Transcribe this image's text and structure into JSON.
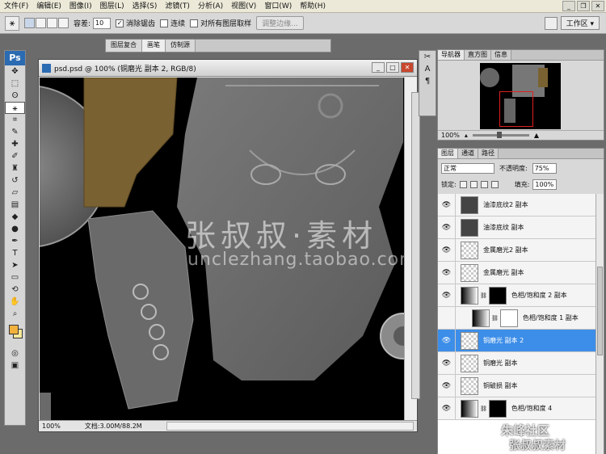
{
  "menu": [
    "文件(F)",
    "编辑(E)",
    "图像(I)",
    "图层(L)",
    "选择(S)",
    "滤镜(T)",
    "分析(A)",
    "视图(V)",
    "窗口(W)",
    "帮助(H)"
  ],
  "options": {
    "tolerance_label": "容差:",
    "tolerance_value": "10",
    "antialias_label": "消除锯齿",
    "contiguous_label": "连续",
    "sample_all_label": "对所有图层取样",
    "refine_edge_label": "调整边缘...",
    "workspace_label": "工作区"
  },
  "tabs": [
    "图层复合",
    "画笔",
    "仿制源"
  ],
  "document": {
    "title": "psd.psd @ 100% (铜磨光 副本 2, RGB/8)",
    "zoom": "100%",
    "doc_size": "文档:3.00M/88.2M"
  },
  "watermark": {
    "chinese": "张叔叔·素材",
    "url": "unclezhang.taobao.com"
  },
  "navigator": {
    "tabs": [
      "导航器",
      "直方图",
      "信息"
    ],
    "zoom": "100%"
  },
  "layers": {
    "tabs": [
      "图层",
      "通道",
      "路径"
    ],
    "blend_mode": "正常",
    "opacity_label": "不透明度:",
    "opacity_value": "75%",
    "lock_label": "锁定:",
    "fill_label": "填充:",
    "fill_value": "100%",
    "items": [
      {
        "name": "油漆底纹2 副本",
        "selected": false
      },
      {
        "name": "油漆底纹 副本",
        "selected": false
      },
      {
        "name": "金属磨光2 副本",
        "selected": false
      },
      {
        "name": "金属磨光 副本",
        "selected": false
      },
      {
        "name": "色相/饱和度 2 副本",
        "selected": false
      },
      {
        "name": "色相/饱和度 1 副本",
        "selected": false
      },
      {
        "name": "铜磨光 副本 2",
        "selected": true
      },
      {
        "name": "铜磨光 副本",
        "selected": false
      },
      {
        "name": "铜破损 副本",
        "selected": false
      },
      {
        "name": "色相/饱和度 4",
        "selected": false
      }
    ]
  },
  "corner_watermark": {
    "line1": "朱峰社区",
    "line2": "张叔叔素材"
  }
}
